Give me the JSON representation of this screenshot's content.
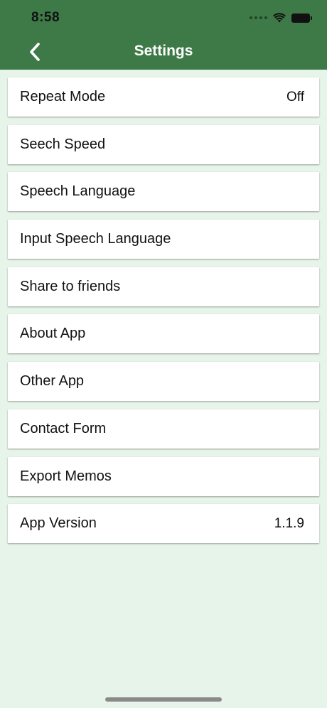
{
  "status_bar": {
    "time": "8:58",
    "wifi_icon": "wifi-icon",
    "battery_icon": "battery-icon"
  },
  "header": {
    "title": "Settings",
    "back_icon": "chevron-left-icon",
    "background": "#3d7a47"
  },
  "settings": {
    "items": [
      {
        "label": "Repeat Mode",
        "value": "Off"
      },
      {
        "label": "Seech Speed",
        "value": ""
      },
      {
        "label": "Speech Language",
        "value": ""
      },
      {
        "label": "Input Speech Language",
        "value": ""
      },
      {
        "label": "Share to friends",
        "value": ""
      },
      {
        "label": "About App",
        "value": ""
      },
      {
        "label": "Other App",
        "value": ""
      },
      {
        "label": "Contact Form",
        "value": ""
      },
      {
        "label": "Export Memos",
        "value": ""
      },
      {
        "label": "App Version",
        "value": "1.1.9"
      }
    ]
  },
  "colors": {
    "background": "#e7f4e9",
    "header": "#3d7a47"
  }
}
